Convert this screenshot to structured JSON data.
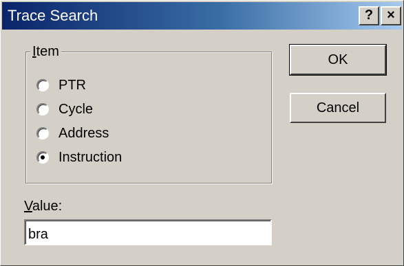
{
  "window": {
    "title": "Trace Search",
    "help_button": "?",
    "close_button": "×"
  },
  "item_group": {
    "legend_prefix": "I",
    "legend_rest": "tem",
    "options": [
      {
        "label": "PTR",
        "checked": false
      },
      {
        "label": "Cycle",
        "checked": false
      },
      {
        "label": "Address",
        "checked": false
      },
      {
        "label": "Instruction",
        "checked": true
      }
    ]
  },
  "value": {
    "label_prefix": "V",
    "label_rest": "alue:",
    "text": "bra"
  },
  "buttons": {
    "ok": "OK",
    "cancel": "Cancel"
  }
}
